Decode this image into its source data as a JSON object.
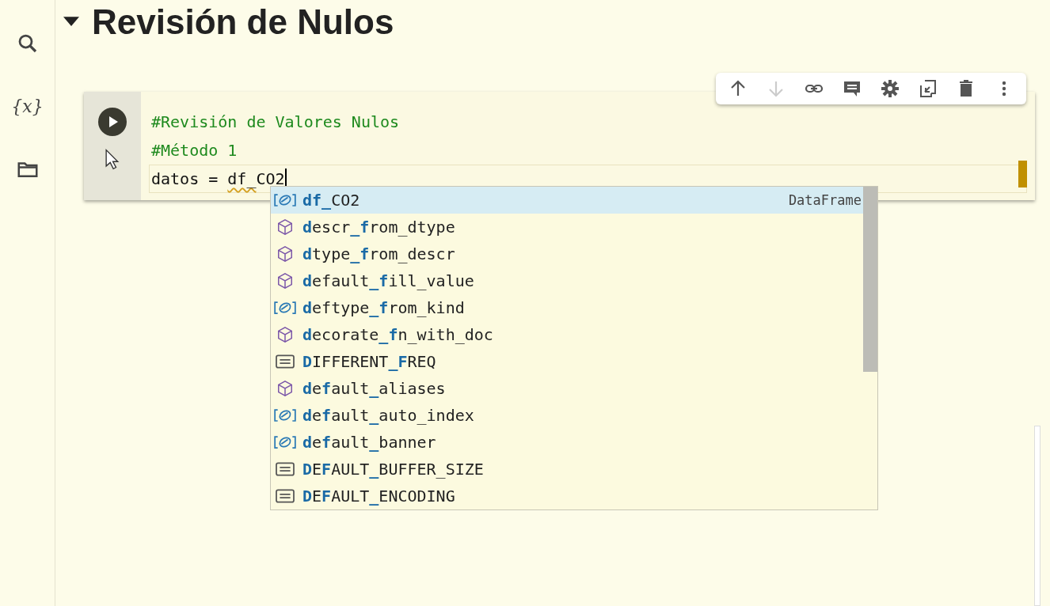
{
  "sidebar": {
    "variables_label": "{x}"
  },
  "section": {
    "title": "Revisión de Nulos",
    "expanded": true
  },
  "toolbar": [
    {
      "kind": "up",
      "disabled": false
    },
    {
      "kind": "down",
      "disabled": true
    },
    {
      "kind": "link",
      "disabled": false
    },
    {
      "kind": "comment",
      "disabled": false
    },
    {
      "kind": "settings",
      "disabled": false
    },
    {
      "kind": "mirror",
      "disabled": false
    },
    {
      "kind": "delete",
      "disabled": false
    },
    {
      "kind": "more",
      "disabled": false
    }
  ],
  "code_lines": [
    {
      "segments": [
        {
          "text": "#Revisión de Valores Nulos",
          "kind": "comment"
        }
      ],
      "current": false
    },
    {
      "segments": [
        {
          "text": "#Método 1",
          "kind": "comment"
        }
      ],
      "current": false
    },
    {
      "segments": [
        {
          "text": "datos = ",
          "kind": "plain"
        },
        {
          "text": "df_",
          "kind": "warning"
        },
        {
          "text": "CO2",
          "kind": "plain"
        }
      ],
      "current": true
    }
  ],
  "suggestions": [
    {
      "kind": "variable",
      "label": "**df_**CO2",
      "detail": "DataFrame",
      "selected": true
    },
    {
      "kind": "method",
      "label": "**d**escr**_f**rom_dtype",
      "selected": false
    },
    {
      "kind": "method",
      "label": "**d**type**_f**rom_descr",
      "selected": false
    },
    {
      "kind": "method",
      "label": "**d**efault**_f**ill_value",
      "selected": false
    },
    {
      "kind": "variable",
      "label": "**d**eftype**_f**rom_kind",
      "selected": false
    },
    {
      "kind": "method",
      "label": "**d**ecorate**_f**n_with_doc",
      "selected": false
    },
    {
      "kind": "constant",
      "label": "**D**IFFERENT**_F**REQ",
      "selected": false
    },
    {
      "kind": "method",
      "label": "**d**e**f**ault**_**aliases",
      "selected": false
    },
    {
      "kind": "variable",
      "label": "**d**e**f**ault**_**auto_index",
      "selected": false
    },
    {
      "kind": "variable",
      "label": "**d**e**f**ault**_**banner",
      "selected": false
    },
    {
      "kind": "constant",
      "label": "**D**E**F**AULT**_**BUFFER_SIZE",
      "selected": false
    },
    {
      "kind": "constant",
      "label": "**D**E**F**AULT**_**ENCODING",
      "selected": false
    }
  ]
}
